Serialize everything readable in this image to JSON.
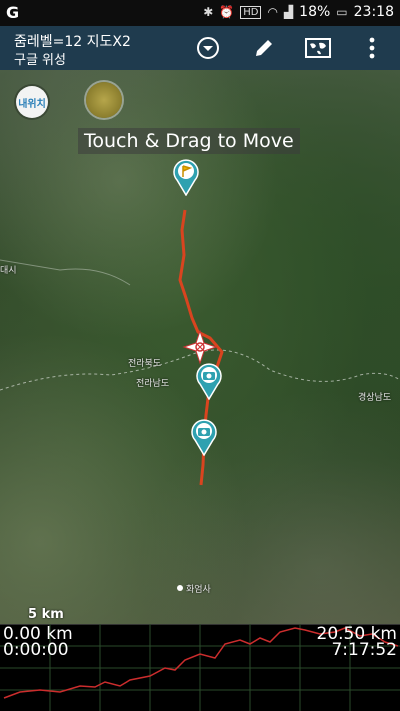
{
  "status_bar": {
    "app_glyph": "G",
    "battery": "18%",
    "time": "23:18",
    "icons": [
      "bluetooth-icon",
      "alarm-icon",
      "hd-icon",
      "wifi-icon",
      "signal-icon",
      "battery-icon"
    ]
  },
  "app_bar": {
    "title_line1": "줌레벨=12 지도X2",
    "title_line2": "구글 위성"
  },
  "map": {
    "my_location_label": "내위치",
    "hint": "Touch & Drag to Move",
    "scale_label": "5 km",
    "place_labels": [
      "전라북도",
      "전라남도",
      "경상남도",
      "화엄사",
      "대시"
    ]
  },
  "elevation_panel": {
    "distance_start": "0.00 km",
    "distance_end": "20.50 km",
    "time_start": "0:00:00",
    "time_end": "7:17:52"
  },
  "colors": {
    "app_bar": "#1f3b4e",
    "track": "#d9441f",
    "marker": "#2fa1b0",
    "profile": "#cc2d2d"
  }
}
